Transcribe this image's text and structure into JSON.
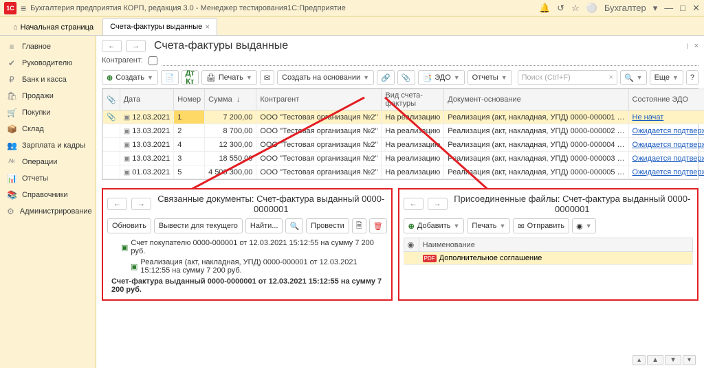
{
  "titlebar": {
    "app_title": "Бухгалтерия предприятия КОРП, редакция 3.0  - Менеджер тестирования1С:Предприятие",
    "user": "Бухгалтер"
  },
  "tabs": {
    "home": "Начальная страница",
    "current": "Счета-фактуры выданные"
  },
  "sidebar": {
    "items": [
      {
        "icon": "≡",
        "label": "Главное"
      },
      {
        "icon": "✔",
        "label": "Руководителю"
      },
      {
        "icon": "₽",
        "label": "Банк и касса"
      },
      {
        "icon": "🛍",
        "label": "Продажи"
      },
      {
        "icon": "🛒",
        "label": "Покупки"
      },
      {
        "icon": "📦",
        "label": "Склад"
      },
      {
        "icon": "👥",
        "label": "Зарплата и кадры"
      },
      {
        "icon": "ᴬᵏ",
        "label": "Операции"
      },
      {
        "icon": "📊",
        "label": "Отчеты"
      },
      {
        "icon": "📚",
        "label": "Справочники"
      },
      {
        "icon": "⚙",
        "label": "Администрирование"
      }
    ]
  },
  "page": {
    "title": "Счета-фактуры выданные",
    "filter_label": "Контрагент:"
  },
  "toolbar": {
    "create": "Создать",
    "print": "Печать",
    "create_based": "Создать на основании",
    "edo": "ЭДО",
    "reports": "Отчеты",
    "search_placeholder": "Поиск (Ctrl+F)",
    "more": "Еще"
  },
  "table": {
    "cols": [
      "Дата",
      "Номер",
      "Сумма",
      "Контрагент",
      "Вид счета-фактуры",
      "Документ-основание",
      "Состояние ЭДО"
    ],
    "rows": [
      {
        "date": "12.03.2021",
        "num": "1",
        "sum": "7 200,00",
        "party": "ООО \"Тестовая организация №2\"",
        "kind": "На реализацию",
        "base": "Реализация (акт, накладная, УПД) 0000-000001 …",
        "edo": "Не начат"
      },
      {
        "date": "13.03.2021",
        "num": "2",
        "sum": "8 700,00",
        "party": "ООО \"Тестовая организация №2\"",
        "kind": "На реализацию",
        "base": "Реализация (акт, накладная, УПД) 0000-000002 …",
        "edo": "Ожидается подтверждение оператора"
      },
      {
        "date": "13.03.2021",
        "num": "4",
        "sum": "12 300,00",
        "party": "ООО \"Тестовая организация №2\"",
        "kind": "На реализацию",
        "base": "Реализация (акт, накладная, УПД) 0000-000004 …",
        "edo": "Ожидается подтверждение оператора"
      },
      {
        "date": "13.03.2021",
        "num": "3",
        "sum": "18 550,00",
        "party": "ООО \"Тестовая организация №2\"",
        "kind": "На реализацию",
        "base": "Реализация (акт, накладная, УПД) 0000-000003 …",
        "edo": "Ожидается подтверждение оператора"
      },
      {
        "date": "01.03.2021",
        "num": "5",
        "sum": "4 500 300,00",
        "party": "ООО \"Тестовая организация №2\"",
        "kind": "На реализацию",
        "base": "Реализация (акт, накладная, УПД) 0000-000005 …",
        "edo": "Ожидается подтверждение оператора"
      }
    ]
  },
  "panel_left": {
    "title": "Связанные документы: Счет-фактура выданный 0000-0000001",
    "btn_refresh": "Обновить",
    "btn_current": "Вывести для текущего",
    "btn_find": "Найти...",
    "btn_post": "Провести",
    "items": [
      "Счет покупателю 0000-000001 от 12.03.2021 15:12:55 на сумму 7 200 руб.",
      "Реализация (акт, накладная, УПД) 0000-000001 от 12.03.2021 15:12:55 на сумму 7 200 руб.",
      "Счет-фактура выданный 0000-0000001 от 12.03.2021 15:12:55 на сумму 7 200 руб."
    ]
  },
  "panel_right": {
    "title": "Присоединенные файлы: Счет-фактура выданный 0000-0000001",
    "btn_add": "Добавить",
    "btn_print": "Печать",
    "btn_send": "Отправить",
    "col_name": "Наименование",
    "file": "Дополнительное соглашение"
  }
}
